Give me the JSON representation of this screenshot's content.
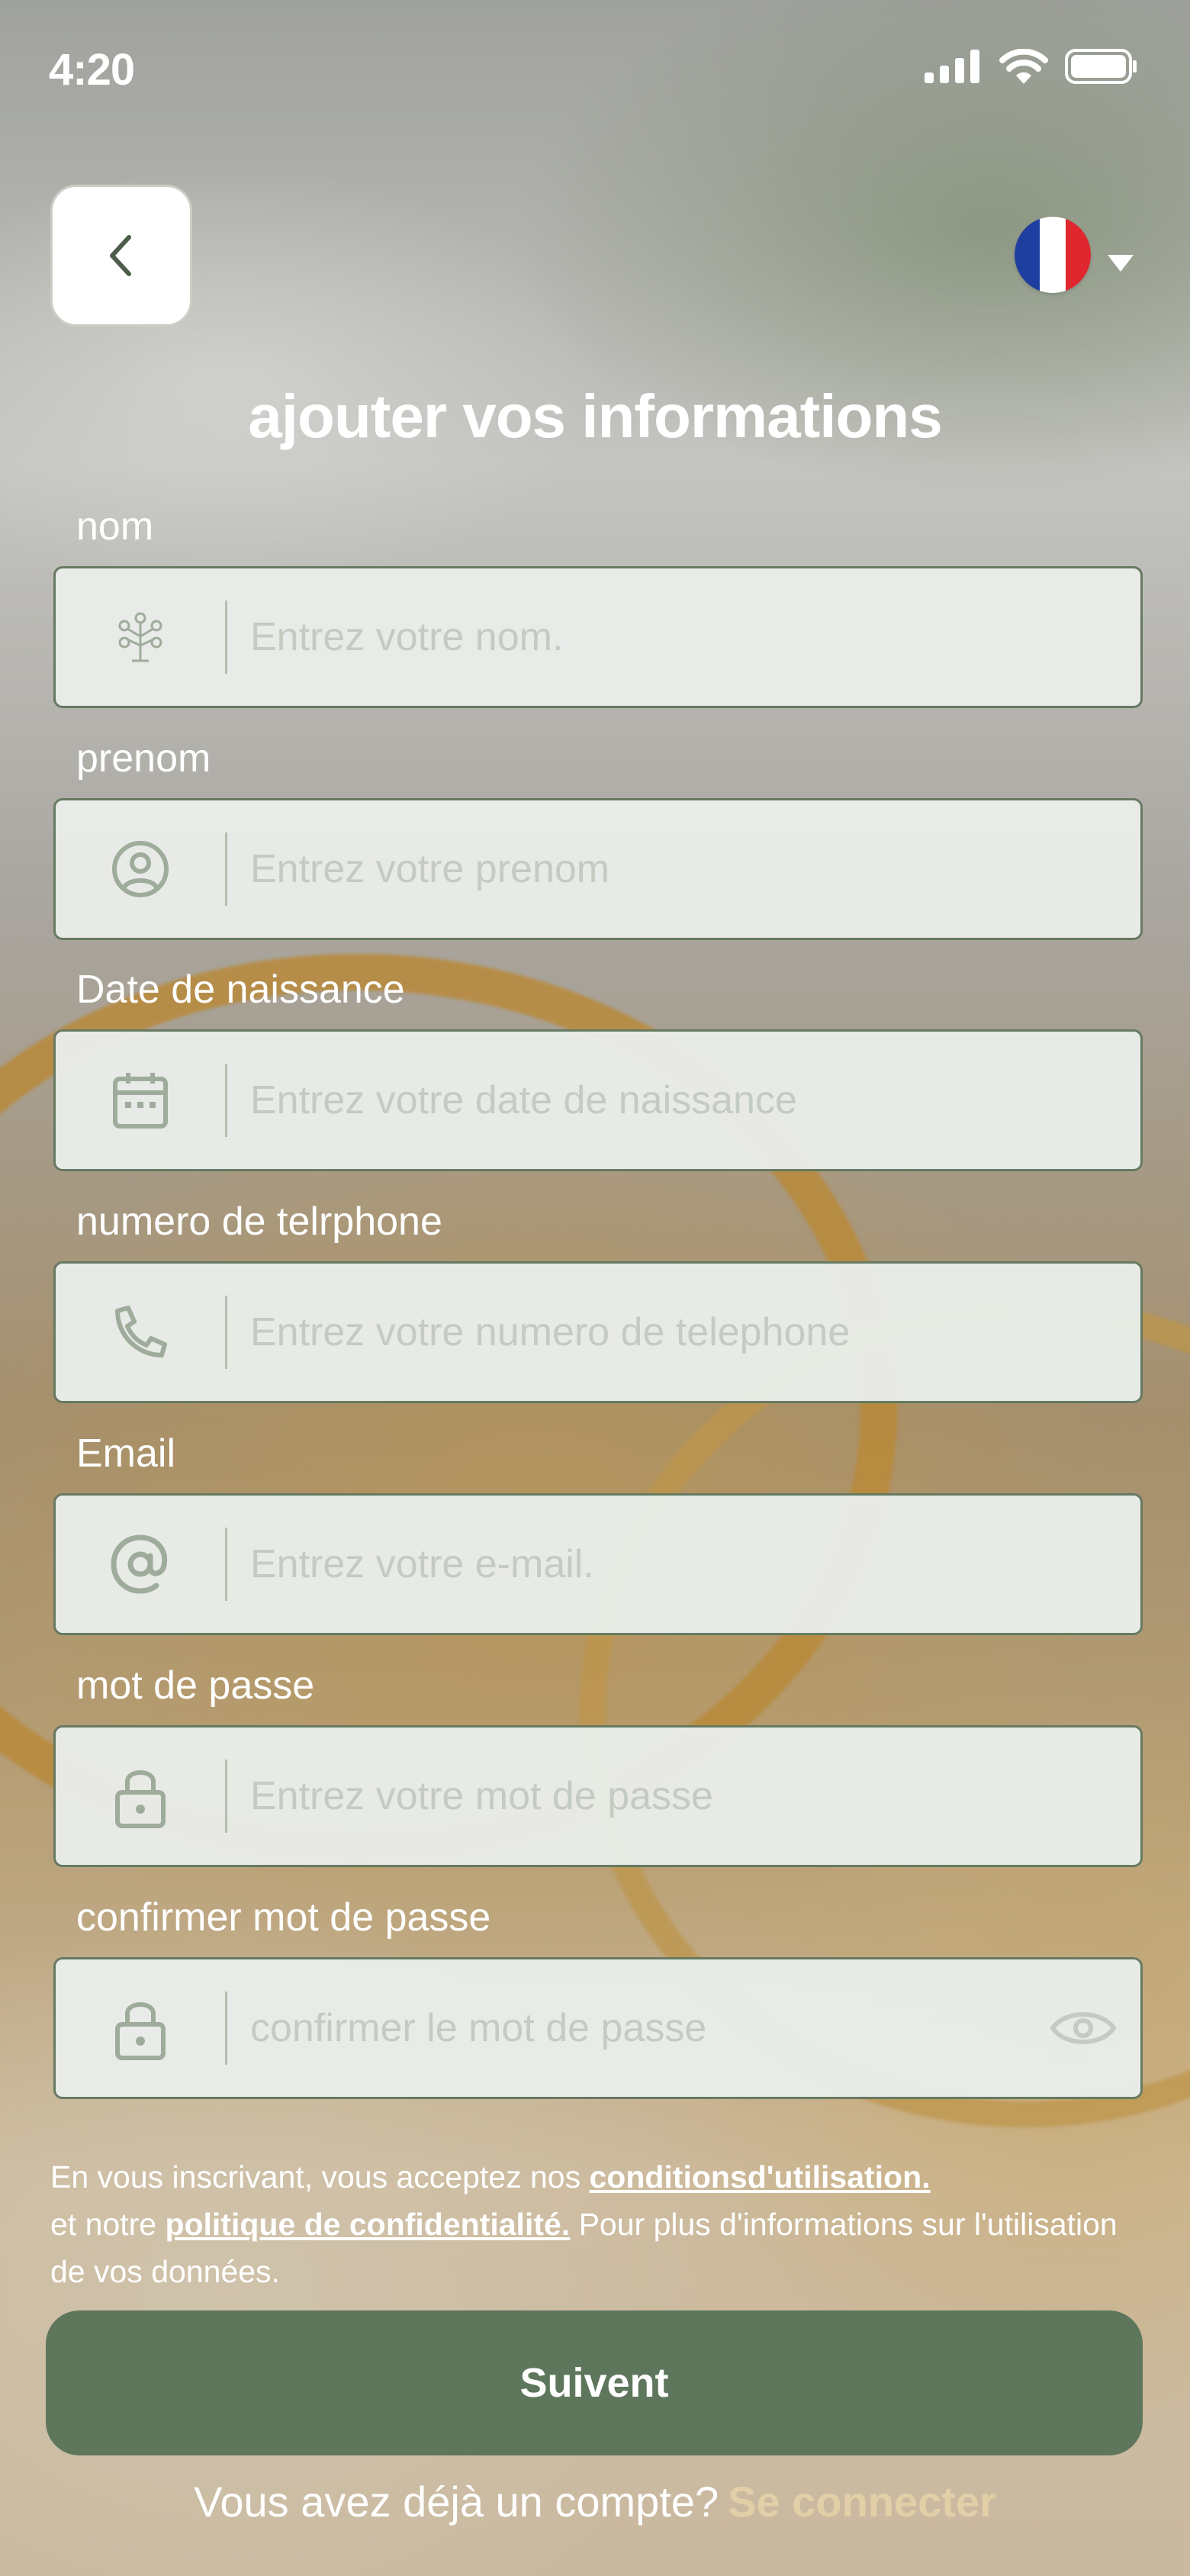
{
  "status_bar": {
    "time": "4:20"
  },
  "header": {
    "title": "ajouter vos informations"
  },
  "language": {
    "flag": "France",
    "colors": [
      "#1f3fa0",
      "#ffffff",
      "#e0262f"
    ]
  },
  "fields": [
    {
      "label": "nom",
      "placeholder": "Entrez votre nom.",
      "icon": "family-tree-icon"
    },
    {
      "label": "prenom",
      "placeholder": "Entrez votre prenom",
      "icon": "user-circle-icon"
    },
    {
      "label": "Date de naissance",
      "placeholder": "Entrez votre date de naissance",
      "icon": "calendar-icon"
    },
    {
      "label": "numero de telrphone",
      "placeholder": "Entrez votre numero de telephone",
      "icon": "phone-icon"
    },
    {
      "label": "Email",
      "placeholder": "Entrez votre e-mail.",
      "icon": "at-sign-icon"
    },
    {
      "label": "mot de passe",
      "placeholder": "Entrez votre mot de passe",
      "icon": "lock-icon"
    },
    {
      "label": "confirmer mot de passe",
      "placeholder": "confirmer le mot de passe",
      "icon": "lock-icon"
    }
  ],
  "terms": {
    "text_1": "En vous inscrivant, vous acceptez nos ",
    "link_1": "conditionsd'utilisation.",
    "text_2": "et notre ",
    "link_2": "politique de confidentialité.",
    "text_3": " Pour plus d'informations sur l'utilisation de vos données."
  },
  "submit_label": "Suivent",
  "login_prompt": {
    "text": "Vous avez déjà un compte?",
    "link": "Se connecter"
  },
  "colors": {
    "primary": "#5e775c",
    "accent_link": "#e2cfa7",
    "input_border": "#667a62",
    "input_bg": "#e9ece9"
  }
}
